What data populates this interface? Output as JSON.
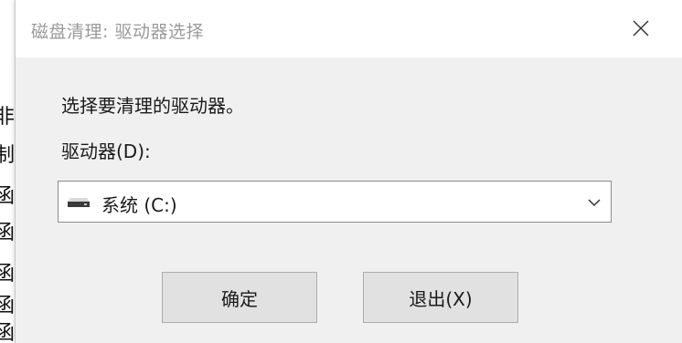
{
  "window": {
    "title": "磁盘清理: 驱动器选择"
  },
  "dialog": {
    "prompt": "选择要清理的驱动器。",
    "drive_label": "驱动器(D):",
    "selected_drive": "系统 (C:)",
    "drive_icon": "hard-drive-icon"
  },
  "buttons": {
    "ok_label": "确定",
    "exit_label": "退出(X)"
  },
  "background": {
    "chars": [
      "非",
      "制",
      "函",
      "函",
      "函",
      "函",
      "函"
    ]
  },
  "colors": {
    "window_bg": "#f0f0f0",
    "titlebar_bg": "#ffffff",
    "button_bg": "#e1e1e1",
    "button_border": "#adadad"
  }
}
